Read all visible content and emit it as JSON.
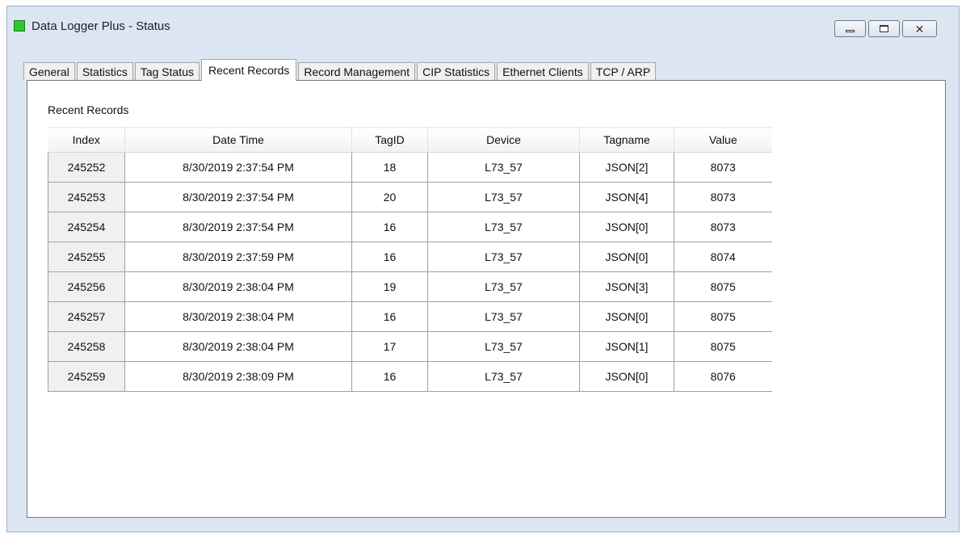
{
  "window": {
    "title": "Data Logger Plus - Status",
    "status_icon_color": "#2fc733"
  },
  "tabs": [
    {
      "label": "General",
      "active": false
    },
    {
      "label": "Statistics",
      "active": false
    },
    {
      "label": "Tag Status",
      "active": false
    },
    {
      "label": "Recent Records",
      "active": true
    },
    {
      "label": "Record Management",
      "active": false
    },
    {
      "label": "CIP Statistics",
      "active": false
    },
    {
      "label": "Ethernet Clients",
      "active": false
    },
    {
      "label": "TCP / ARP",
      "active": false
    }
  ],
  "recent_records": {
    "section_label": "Recent Records",
    "columns": [
      "Index",
      "Date Time",
      "TagID",
      "Device",
      "Tagname",
      "Value"
    ],
    "rows": [
      [
        "245252",
        "8/30/2019 2:37:54 PM",
        "18",
        "L73_57",
        "JSON[2]",
        "8073"
      ],
      [
        "245253",
        "8/30/2019 2:37:54 PM",
        "20",
        "L73_57",
        "JSON[4]",
        "8073"
      ],
      [
        "245254",
        "8/30/2019 2:37:54 PM",
        "16",
        "L73_57",
        "JSON[0]",
        "8073"
      ],
      [
        "245255",
        "8/30/2019 2:37:59 PM",
        "16",
        "L73_57",
        "JSON[0]",
        "8074"
      ],
      [
        "245256",
        "8/30/2019 2:38:04 PM",
        "19",
        "L73_57",
        "JSON[3]",
        "8075"
      ],
      [
        "245257",
        "8/30/2019 2:38:04 PM",
        "16",
        "L73_57",
        "JSON[0]",
        "8075"
      ],
      [
        "245258",
        "8/30/2019 2:38:04 PM",
        "17",
        "L73_57",
        "JSON[1]",
        "8075"
      ],
      [
        "245259",
        "8/30/2019 2:38:09 PM",
        "16",
        "L73_57",
        "JSON[0]",
        "8076"
      ]
    ]
  }
}
